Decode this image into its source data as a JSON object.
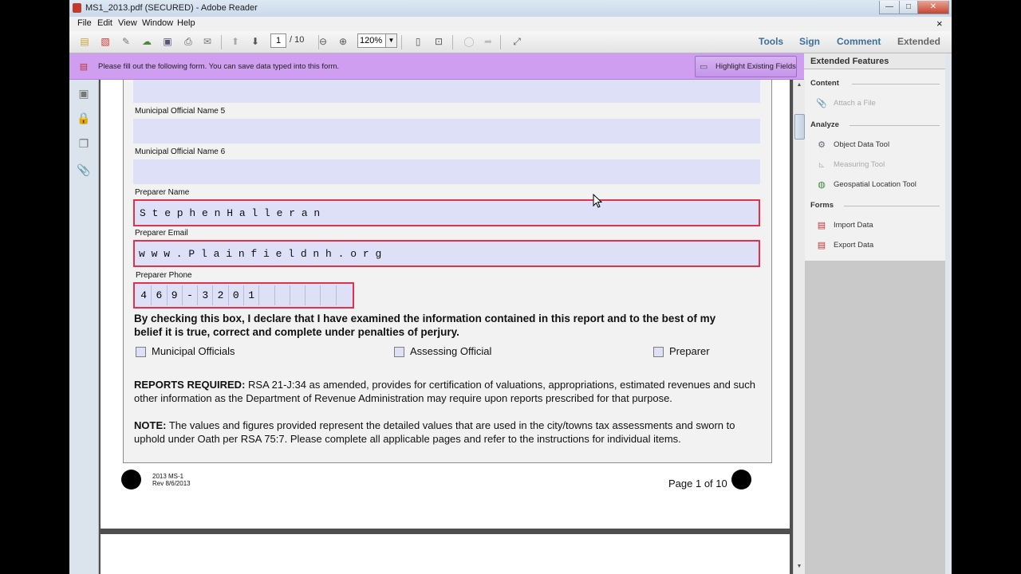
{
  "window": {
    "title": "MS1_2013.pdf (SECURED) - Adobe Reader",
    "controls": {
      "minimize": "—",
      "maximize": "□",
      "close": "✕"
    }
  },
  "menu": [
    "File",
    "Edit",
    "View",
    "Window",
    "Help"
  ],
  "toolbar": {
    "page_current": "1",
    "page_total": "/ 10",
    "zoom": "120%",
    "links": [
      "Tools",
      "Sign",
      "Comment",
      "Extended"
    ],
    "close_x": "×"
  },
  "infobar": {
    "message": "Please fill out the following form. You can save data typed into this form.",
    "highlight_button": "Highlight Existing Fields"
  },
  "right_panel": {
    "header": "Extended Features",
    "sections": [
      {
        "title": "Content",
        "items": [
          {
            "label": "Attach a File",
            "disabled": true,
            "icon": "paperclip-icon"
          }
        ]
      },
      {
        "title": "Analyze",
        "items": [
          {
            "label": "Object Data Tool",
            "disabled": false,
            "icon": "object-data-icon"
          },
          {
            "label": "Measuring Tool",
            "disabled": true,
            "icon": "ruler-icon"
          },
          {
            "label": "Geospatial Location Tool",
            "disabled": false,
            "icon": "globe-icon"
          }
        ]
      },
      {
        "title": "Forms",
        "items": [
          {
            "label": "Import Data",
            "disabled": false,
            "icon": "import-data-icon"
          },
          {
            "label": "Export Data",
            "disabled": false,
            "icon": "export-data-icon"
          }
        ]
      }
    ]
  },
  "form": {
    "label_official5": "Municipal Official Name 5",
    "label_official6": "Municipal Official Name 6",
    "label_preparer_name": "Preparer Name",
    "preparer_name": "S t e p h e n   H a l l e r a n",
    "label_preparer_email": "Preparer Email",
    "preparer_email": "w w w . P l a i n f i e l d n h . o r g",
    "label_preparer_phone": "Preparer Phone",
    "phone_digits": [
      "4",
      "6",
      "9",
      "-",
      "3",
      "2",
      "0",
      "1",
      "",
      "",
      "",
      "",
      "",
      ""
    ],
    "declaration_line1": "By checking this box, I declare that I have examined the information contained in this report and to the best of my",
    "declaration_line2": "belief it is true, correct and complete under penalties of perjury.",
    "checkboxes": [
      "Municipal Officials",
      "Assessing Official",
      "Preparer"
    ],
    "reports_bold": "REPORTS REQUIRED:",
    "reports_text": " RSA 21-J:34 as amended, provides for certification of valuations, appropriations, estimated revenues and such other information as the Department of Revenue Administration may require upon reports prescribed for that purpose.",
    "note_bold": "NOTE:",
    "note_text": " The values and figures provided represent the detailed values that are used in the city/towns tax assessments and sworn to uphold under Oath per RSA 75:7.  Please complete all applicable pages and refer to the instructions for individual items."
  },
  "footer": {
    "form_id": "2013 MS-1",
    "revision": "Rev 8/6/2013",
    "page_of": "Page 1 of 10"
  }
}
